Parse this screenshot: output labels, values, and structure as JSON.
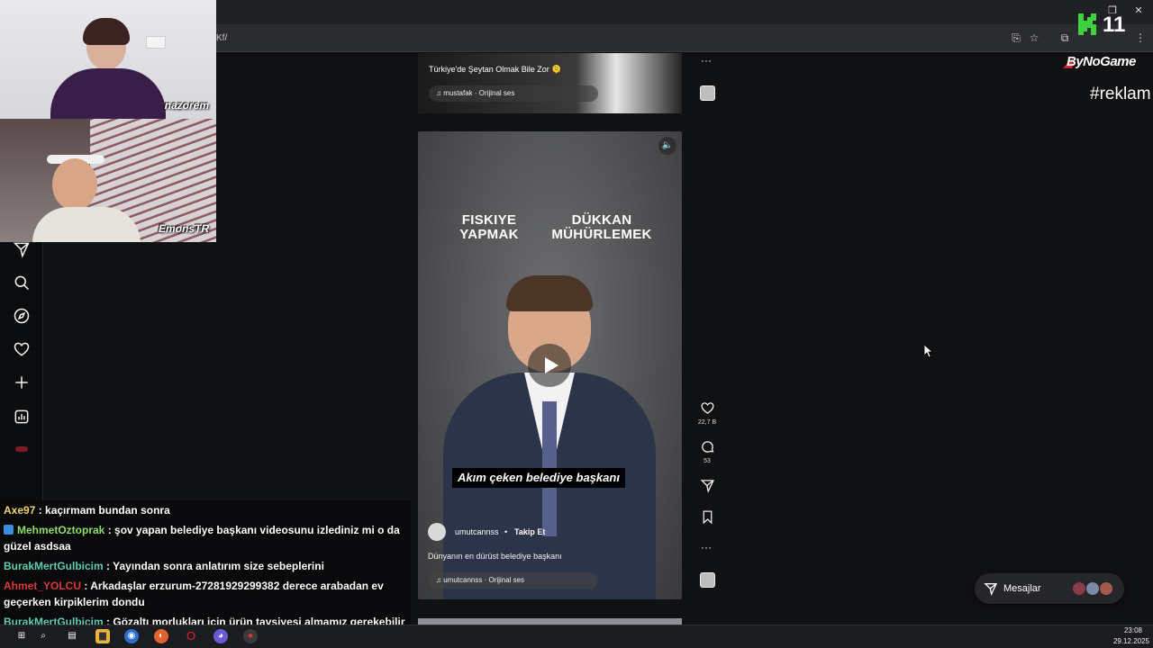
{
  "browser": {
    "url": "Kf/"
  },
  "webcams": [
    {
      "tag": "nazorem"
    },
    {
      "tag": "EmonsTR"
    }
  ],
  "reel_top": {
    "caption": "Türkiye'de Şeytan Olmak Bile Zor 🫠",
    "audio": "♫ mustafak · Orijinal ses"
  },
  "reel_main": {
    "overlay_left": "FISKIYE YAPMAK",
    "overlay_right": "DÜKKAN MÜHÜRLEMEK",
    "subtitle": "Akım çeken belediye başkanı",
    "author": "umutcannss",
    "dot": "•",
    "follow": "Takip Et",
    "caption": "Dünyanın en dürüst belediye başkanı",
    "audio": "♫ umutcannss · Orijinal ses"
  },
  "rail": {
    "likes": "22,7 B",
    "comments": "53"
  },
  "overlays": {
    "k_number": "11",
    "bynogame": "ByNoGame",
    "reklam": "#reklam"
  },
  "messages": {
    "label": "Mesajlar"
  },
  "chat": [
    {
      "user": "Axe97",
      "color": "#f5d36b",
      "text": " : kaçırmam bundan sonra"
    },
    {
      "user": "MehmetOztoprak",
      "color": "#8ee06b",
      "text": " : şov yapan belediye başkanı videosunu izlediniz mi o da güzel asdsaa"
    },
    {
      "user": "BurakMertGulbicim",
      "color": "#5fd0b5",
      "text": " : Yayından sonra anlatırım size sebeplerini"
    },
    {
      "user": "Ahmet_YOLCU",
      "color": "#e03a3a",
      "text": " : Arkadaşlar erzurum-27281929299382 derece arabadan ev geçerken kirpiklerim dondu"
    },
    {
      "user": "BurakMertGulbicim",
      "color": "#5fd0b5",
      "text": " : Gözaltı morlukları için ürün tavsiyesi almamız gerekebilir olmaz"
    }
  ],
  "taskbar": {
    "time": "23:08",
    "date": "29.12.2025"
  },
  "colors": {
    "page_bg": "#101113",
    "chrome_bg": "#202124",
    "accent_k": "#3fd13f"
  }
}
